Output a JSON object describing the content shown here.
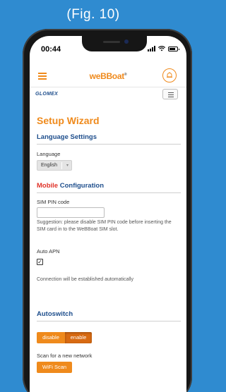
{
  "figure_label": "(Fig. 10)",
  "status_bar": {
    "time": "00:44"
  },
  "header": {
    "brand": "weBBoat",
    "brand_mark": "®",
    "sub_brand": "GLOMEX"
  },
  "page": {
    "title": "Setup Wizard"
  },
  "language_settings": {
    "heading": "Language Settings",
    "language_label": "Language",
    "language_value": "English"
  },
  "mobile_config": {
    "heading_red": "Mobile",
    "heading_rest": " Configuration",
    "pin_label": "SIM PIN code",
    "pin_value": "",
    "suggestion": "Suggestion: please disable SIM PIN code before inserting the SIM card in to the WeBBoat SIM slot.",
    "auto_apn_label": "Auto APN",
    "auto_apn_checked": true,
    "check_mark": "✓",
    "connection_note": "Connection will be established automatically"
  },
  "autoswitch": {
    "heading": "Autoswitch",
    "disable_label": "disable",
    "enable_label": "enable",
    "selected": "enable",
    "scan_label": "Scan for a new network",
    "wifi_scan_label": "WiFi Scan"
  },
  "colors": {
    "accent": "#ef8a1c",
    "heading_blue": "#1e4e8c",
    "mobile_red": "#e03228",
    "background": "#2f8bd0"
  },
  "icons": [
    "hamburger-icon",
    "alarm-icon",
    "menu-icon",
    "signal-icon",
    "wifi-icon",
    "battery-icon"
  ]
}
